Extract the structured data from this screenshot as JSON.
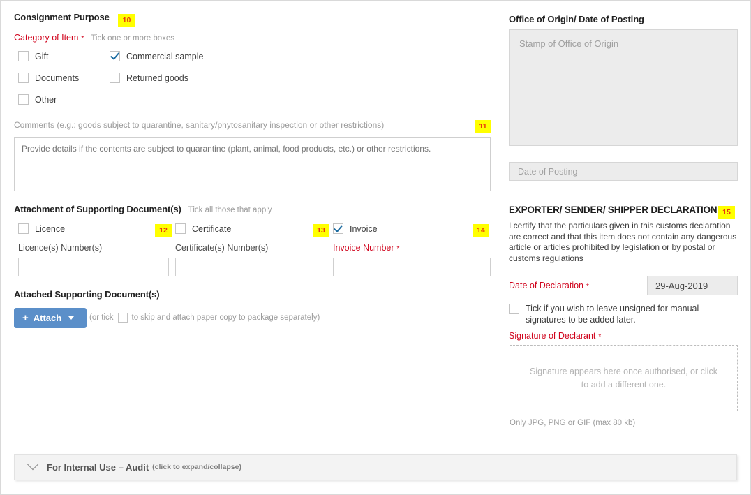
{
  "consignment": {
    "heading": "Consignment Purpose",
    "badge": "10",
    "category_label": "Category of Item",
    "category_required_star": "*",
    "category_hint": "Tick one or more boxes",
    "checkboxes": [
      {
        "label": "Gift",
        "checked": false
      },
      {
        "label": "Commercial sample",
        "checked": true
      },
      {
        "label": "Documents",
        "checked": false
      },
      {
        "label": "Returned goods",
        "checked": false
      },
      {
        "label": "Other",
        "checked": false
      }
    ],
    "comments_label": "Comments (e.g.: goods subject to quarantine, sanitary/phytosanitary inspection or other restrictions)",
    "comments_badge": "11",
    "comments_placeholder": "Provide details if the contents are subject to quarantine (plant, animal, food products, etc.) or other restrictions."
  },
  "attachment": {
    "heading": "Attachment of Supporting Document(s)",
    "hint": "Tick all those that apply",
    "items": [
      {
        "checkbox_label": "Licence",
        "checked": false,
        "badge": "12",
        "field_label": "Licence(s) Number(s)",
        "required": false,
        "value": ""
      },
      {
        "checkbox_label": "Certificate",
        "checked": false,
        "badge": "13",
        "field_label": "Certificate(s) Number(s)",
        "required": false,
        "value": ""
      },
      {
        "checkbox_label": "Invoice",
        "checked": true,
        "badge": "14",
        "field_label": "Invoice Number",
        "required": true,
        "value": ""
      }
    ],
    "invoice_required_star": "*"
  },
  "attached_docs": {
    "heading": "Attached Supporting Document(s)",
    "attach_button_label": "Attach",
    "attach_plus": "+",
    "skip_text_before": "(or tick",
    "skip_text_after": "to skip and attach paper copy to package separately)",
    "skip_checked": false
  },
  "office_origin": {
    "heading": "Office of Origin/ Date of Posting",
    "stamp_placeholder": "Stamp of Office of Origin",
    "date_posting_placeholder": "Date of Posting"
  },
  "declaration": {
    "heading": "EXPORTER/ SENDER/ SHIPPER DECLARATION",
    "badge": "15",
    "body": "I certify that the particulars given in this customs declaration are correct and that this item does not contain any dangerous article or articles prohibited by legislation or by postal or customs regulations",
    "date_label": "Date of Declaration",
    "date_required_star": "*",
    "date_value": "29-Aug-2019",
    "unsigned_checkbox_label": "Tick if you wish to leave unsigned for manual signatures to be added later.",
    "unsigned_checked": false,
    "signature_label": "Signature of Declarant",
    "signature_required_star": "*",
    "signature_placeholder": "Signature appears here once authorised, or click to add a different one.",
    "file_hint": "Only JPG, PNG or GIF (max 80 kb)"
  },
  "audit": {
    "title": "For Internal Use – Audit",
    "subtitle": "(click to expand/collapse)",
    "chevron": "chevron-down-icon"
  },
  "colors": {
    "required_red": "#d0021b",
    "badge_bg": "#ffff00",
    "badge_text": "#e8380d",
    "button_blue": "#5b8fc9",
    "checkmark_blue": "#1c6ca1"
  }
}
